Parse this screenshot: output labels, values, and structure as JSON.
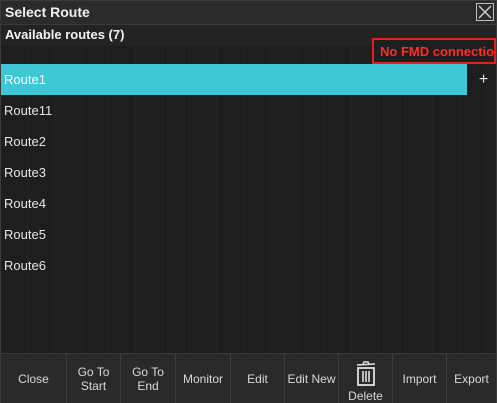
{
  "window": {
    "title": "Select Route"
  },
  "header": {
    "available_label": "Available routes (7)",
    "warning": "No FMD connection"
  },
  "routes": [
    {
      "label": "Route1",
      "selected": true
    },
    {
      "label": "Route11",
      "selected": false
    },
    {
      "label": "Route2",
      "selected": false
    },
    {
      "label": "Route3",
      "selected": false
    },
    {
      "label": "Route4",
      "selected": false
    },
    {
      "label": "Route5",
      "selected": false
    },
    {
      "label": "Route6",
      "selected": false
    }
  ],
  "add_button": "+",
  "toolbar": {
    "close": "Close",
    "go_to_start": "Go To Start",
    "go_to_end": "Go To End",
    "monitor": "Monitor",
    "edit": "Edit",
    "edit_new": "Edit New",
    "delete": "Delete",
    "import": "Import",
    "export": "Export"
  },
  "colors": {
    "selection": "#3fc7d6",
    "warning": "#ff2a2a",
    "background": "#1e1e1e"
  }
}
